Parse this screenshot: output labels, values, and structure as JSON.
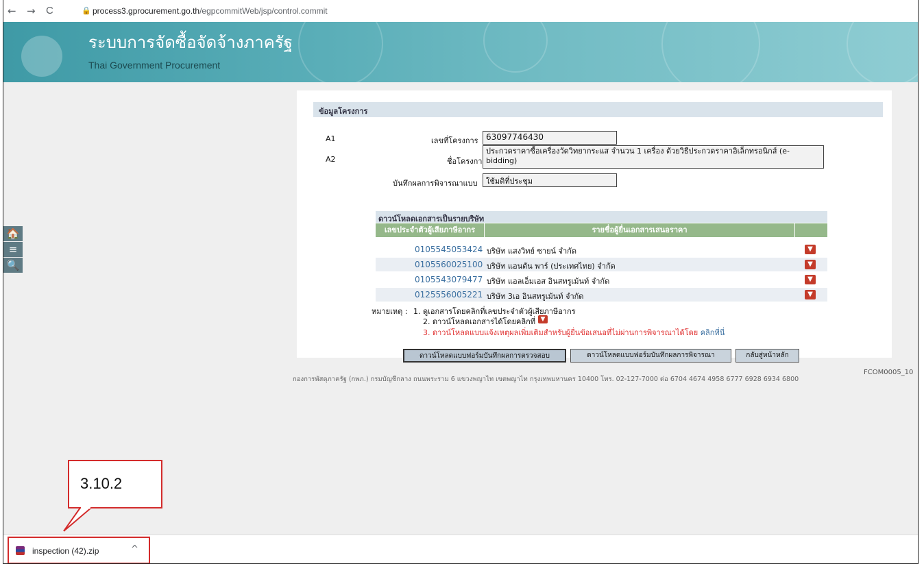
{
  "browser": {
    "back": "←",
    "forward": "→",
    "reload": "C",
    "url_host": "process3.gprocurement.go.th",
    "url_path": "/egpcommitWeb/jsp/control.commit"
  },
  "header": {
    "title": "ระบบการจัดซื้อจัดจ้างภาครัฐ",
    "subtitle": "Thai Government Procurement"
  },
  "side": {
    "home": "🏠",
    "menu": "≡",
    "search": "🔍"
  },
  "project": {
    "section_title": "ข้อมูลโครงการ",
    "a1_code": "A1",
    "a2_code": "A2",
    "project_no_label": "เลขที่โครงการ",
    "project_no_value": "63097746430",
    "project_name_label": "ชื่อโครงการ",
    "project_name_value": "ประกวดราคาซื้อเครื่องวัดวิทยากระแส จำนวน 1 เครื่อง ด้วยวิธีประกวดราคาอิเล็กทรอนิกส์ (e-bidding)",
    "record_label": "บันทึกผลการพิจารณาแบบ",
    "record_value": "ใช้มติที่ประชุม"
  },
  "download": {
    "section_title": "ดาวน์โหลดเอกสารเป็นรายบริษัท",
    "col_tax": "เลขประจำตัวผู้เสียภาษีอากร",
    "col_name": "รายชื่อผู้ยื่นเอกสารเสนอราคา",
    "rows": [
      {
        "tax": "0105545053424",
        "name": "บริษัท แสงวิทย์ ซายน์ จำกัด"
      },
      {
        "tax": "0105560025100",
        "name": "บริษัท แอนตัน พาร์ (ประเทศไทย) จำกัด"
      },
      {
        "tax": "0105543079477",
        "name": "บริษัท แอลเอ็มเอส อินสทรูเม้นท์ จำกัด"
      },
      {
        "tax": "0125556005221",
        "name": "บริษัท 3เอ อินสทรูเม้นท์ จำกัด"
      }
    ]
  },
  "notes": {
    "prefix": "หมายเหตุ :",
    "n1": "1. ดูเอกสารโดยคลิกที่เลขประจำตัวผู้เสียภาษีอากร",
    "n2": "2. ดาวน์โหลดเอกสารได้โดยคลิกที่",
    "n3": "3. ดาวน์โหลดแบบแจ้งเหตุผลเพิ่มเติมสำหรับผู้ยื่นข้อเสนอที่ไม่ผ่านการพิจารณาได้โดย",
    "n3_link": "คลิกที่นี่"
  },
  "buttons": {
    "inspection": "ดาวน์โหลดแบบฟอร์มบันทึกผลการตรวจสอบ",
    "consideration": "ดาวน์โหลดแบบฟอร์มบันทึกผลการพิจารณา",
    "back_home": "กลับสู่หน้าหลัก"
  },
  "footer": {
    "text": "กองการพัสดุภาครัฐ (กพภ.) กรมบัญชีกลาง ถนนพระราม 6 แขวงพญาไท เขตพญาไท กรุงเทพมหานคร 10400 โทร. 02-127-7000 ต่อ 6704 4674 4958 6777 6928 6934 6800",
    "code": "FCOM0005_10"
  },
  "callout": {
    "label": "3.10.2"
  },
  "download_bar": {
    "file_name": "inspection (42).zip",
    "chevron": "^"
  }
}
